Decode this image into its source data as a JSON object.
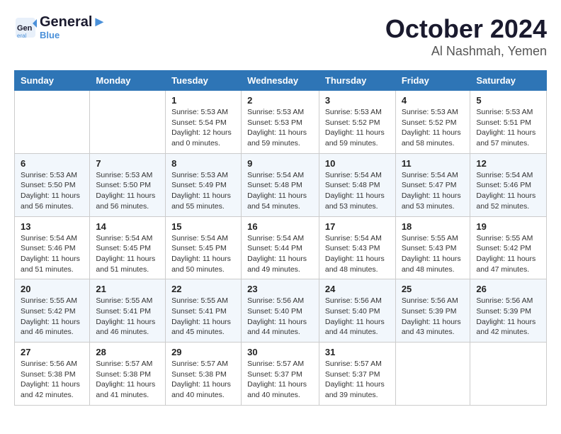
{
  "header": {
    "logo_line1": "General",
    "logo_line2": "Blue",
    "title": "October 2024",
    "subtitle": "Al Nashmah, Yemen"
  },
  "columns": [
    "Sunday",
    "Monday",
    "Tuesday",
    "Wednesday",
    "Thursday",
    "Friday",
    "Saturday"
  ],
  "weeks": [
    [
      {
        "day": "",
        "info": ""
      },
      {
        "day": "",
        "info": ""
      },
      {
        "day": "1",
        "info": "Sunrise: 5:53 AM\nSunset: 5:54 PM\nDaylight: 12 hours and 0 minutes."
      },
      {
        "day": "2",
        "info": "Sunrise: 5:53 AM\nSunset: 5:53 PM\nDaylight: 11 hours and 59 minutes."
      },
      {
        "day": "3",
        "info": "Sunrise: 5:53 AM\nSunset: 5:52 PM\nDaylight: 11 hours and 59 minutes."
      },
      {
        "day": "4",
        "info": "Sunrise: 5:53 AM\nSunset: 5:52 PM\nDaylight: 11 hours and 58 minutes."
      },
      {
        "day": "5",
        "info": "Sunrise: 5:53 AM\nSunset: 5:51 PM\nDaylight: 11 hours and 57 minutes."
      }
    ],
    [
      {
        "day": "6",
        "info": "Sunrise: 5:53 AM\nSunset: 5:50 PM\nDaylight: 11 hours and 56 minutes."
      },
      {
        "day": "7",
        "info": "Sunrise: 5:53 AM\nSunset: 5:50 PM\nDaylight: 11 hours and 56 minutes."
      },
      {
        "day": "8",
        "info": "Sunrise: 5:53 AM\nSunset: 5:49 PM\nDaylight: 11 hours and 55 minutes."
      },
      {
        "day": "9",
        "info": "Sunrise: 5:54 AM\nSunset: 5:48 PM\nDaylight: 11 hours and 54 minutes."
      },
      {
        "day": "10",
        "info": "Sunrise: 5:54 AM\nSunset: 5:48 PM\nDaylight: 11 hours and 53 minutes."
      },
      {
        "day": "11",
        "info": "Sunrise: 5:54 AM\nSunset: 5:47 PM\nDaylight: 11 hours and 53 minutes."
      },
      {
        "day": "12",
        "info": "Sunrise: 5:54 AM\nSunset: 5:46 PM\nDaylight: 11 hours and 52 minutes."
      }
    ],
    [
      {
        "day": "13",
        "info": "Sunrise: 5:54 AM\nSunset: 5:46 PM\nDaylight: 11 hours and 51 minutes."
      },
      {
        "day": "14",
        "info": "Sunrise: 5:54 AM\nSunset: 5:45 PM\nDaylight: 11 hours and 51 minutes."
      },
      {
        "day": "15",
        "info": "Sunrise: 5:54 AM\nSunset: 5:45 PM\nDaylight: 11 hours and 50 minutes."
      },
      {
        "day": "16",
        "info": "Sunrise: 5:54 AM\nSunset: 5:44 PM\nDaylight: 11 hours and 49 minutes."
      },
      {
        "day": "17",
        "info": "Sunrise: 5:54 AM\nSunset: 5:43 PM\nDaylight: 11 hours and 48 minutes."
      },
      {
        "day": "18",
        "info": "Sunrise: 5:55 AM\nSunset: 5:43 PM\nDaylight: 11 hours and 48 minutes."
      },
      {
        "day": "19",
        "info": "Sunrise: 5:55 AM\nSunset: 5:42 PM\nDaylight: 11 hours and 47 minutes."
      }
    ],
    [
      {
        "day": "20",
        "info": "Sunrise: 5:55 AM\nSunset: 5:42 PM\nDaylight: 11 hours and 46 minutes."
      },
      {
        "day": "21",
        "info": "Sunrise: 5:55 AM\nSunset: 5:41 PM\nDaylight: 11 hours and 46 minutes."
      },
      {
        "day": "22",
        "info": "Sunrise: 5:55 AM\nSunset: 5:41 PM\nDaylight: 11 hours and 45 minutes."
      },
      {
        "day": "23",
        "info": "Sunrise: 5:56 AM\nSunset: 5:40 PM\nDaylight: 11 hours and 44 minutes."
      },
      {
        "day": "24",
        "info": "Sunrise: 5:56 AM\nSunset: 5:40 PM\nDaylight: 11 hours and 44 minutes."
      },
      {
        "day": "25",
        "info": "Sunrise: 5:56 AM\nSunset: 5:39 PM\nDaylight: 11 hours and 43 minutes."
      },
      {
        "day": "26",
        "info": "Sunrise: 5:56 AM\nSunset: 5:39 PM\nDaylight: 11 hours and 42 minutes."
      }
    ],
    [
      {
        "day": "27",
        "info": "Sunrise: 5:56 AM\nSunset: 5:38 PM\nDaylight: 11 hours and 42 minutes."
      },
      {
        "day": "28",
        "info": "Sunrise: 5:57 AM\nSunset: 5:38 PM\nDaylight: 11 hours and 41 minutes."
      },
      {
        "day": "29",
        "info": "Sunrise: 5:57 AM\nSunset: 5:38 PM\nDaylight: 11 hours and 40 minutes."
      },
      {
        "day": "30",
        "info": "Sunrise: 5:57 AM\nSunset: 5:37 PM\nDaylight: 11 hours and 40 minutes."
      },
      {
        "day": "31",
        "info": "Sunrise: 5:57 AM\nSunset: 5:37 PM\nDaylight: 11 hours and 39 minutes."
      },
      {
        "day": "",
        "info": ""
      },
      {
        "day": "",
        "info": ""
      }
    ]
  ]
}
